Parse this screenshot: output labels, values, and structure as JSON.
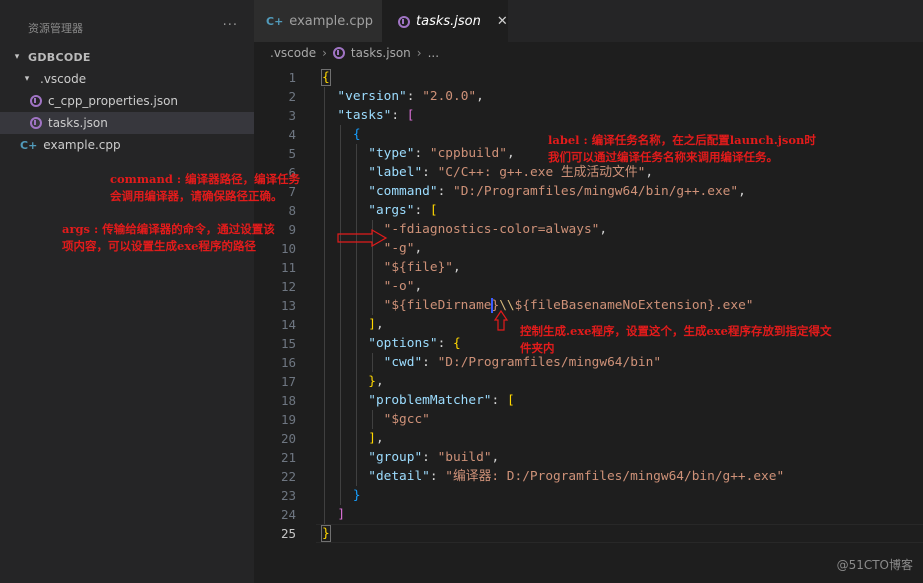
{
  "sidebar": {
    "title": "资源管理器",
    "more": "···",
    "section": "GDBCODE",
    "items": [
      {
        "label": ".vscode",
        "type": "folder"
      },
      {
        "label": "c_cpp_properties.json",
        "type": "json"
      },
      {
        "label": "tasks.json",
        "type": "json"
      },
      {
        "label": "example.cpp",
        "type": "cpp"
      }
    ]
  },
  "tabs": [
    {
      "label": "example.cpp",
      "icon": "cpp-icon",
      "active": false
    },
    {
      "label": "tasks.json",
      "icon": "json-icon",
      "active": true,
      "close": "✕"
    }
  ],
  "breadcrumb": {
    "folder": ".vscode",
    "file": "tasks.json",
    "symbol": "..."
  },
  "editor": {
    "current_line": 25,
    "line_numbers": [
      "1",
      "2",
      "3",
      "4",
      "5",
      "6",
      "7",
      "8",
      "9",
      "10",
      "11",
      "12",
      "13",
      "14",
      "15",
      "16",
      "17",
      "18",
      "19",
      "20",
      "21",
      "22",
      "23",
      "24",
      "25"
    ],
    "tokens": {
      "version_key": "\"version\"",
      "version_val": "\"2.0.0\"",
      "tasks_key": "\"tasks\"",
      "type_key": "\"type\"",
      "type_val": "\"cppbuild\"",
      "label_key": "\"label\"",
      "label_val": "\"C/C++: g++.exe 生成活动文件\"",
      "command_key": "\"command\"",
      "command_val": "\"D:/Programfiles/mingw64/bin/g++.exe\"",
      "args_key": "\"args\"",
      "arg1": "\"-fdiagnostics-color=always\"",
      "arg2": "\"-g\"",
      "arg3": "\"${file}\"",
      "arg4": "\"-o\"",
      "arg5a": "\"${fileDirname}",
      "arg5b": "\\\\",
      "arg5c": "${fileBasenameNoExtension}.exe\"",
      "options_key": "\"options\"",
      "cwd_key": "\"cwd\"",
      "cwd_val": "\"D:/Programfiles/mingw64/bin\"",
      "pm_key": "\"problemMatcher\"",
      "pm_val": "\"$gcc\"",
      "group_key": "\"group\"",
      "group_val": "\"build\"",
      "detail_key": "\"detail\"",
      "detail_val": "\"编译器: D:/Programfiles/mingw64/bin/g++.exe\""
    }
  },
  "annotations": {
    "label_note_1": "label : 编译任务名称，在之后配置launch.json时",
    "label_note_2": "我们可以通过编译任务名称来调用编译任务。",
    "command_note_1": "command : 编译器路径，编译任务",
    "command_note_2": "会调用编译器，请确保路径正确。",
    "args_note_1": "args : 传输给编译器的命令，通过设置该",
    "args_note_2": "项内容，可以设置生成exe程序的路径",
    "exe_note_1": "控制生成.exe程序，设置这个，生成exe程序存放到指定得文",
    "exe_note_2": "件夹内"
  },
  "watermark": "@51CTO博客",
  "colors": {
    "annotation": "#e21b1b",
    "key": "#9cdcfe",
    "string": "#ce9178",
    "bracket_gold": "#ffd700",
    "bracket_purple": "#da70d6",
    "bracket_blue": "#179fff"
  }
}
